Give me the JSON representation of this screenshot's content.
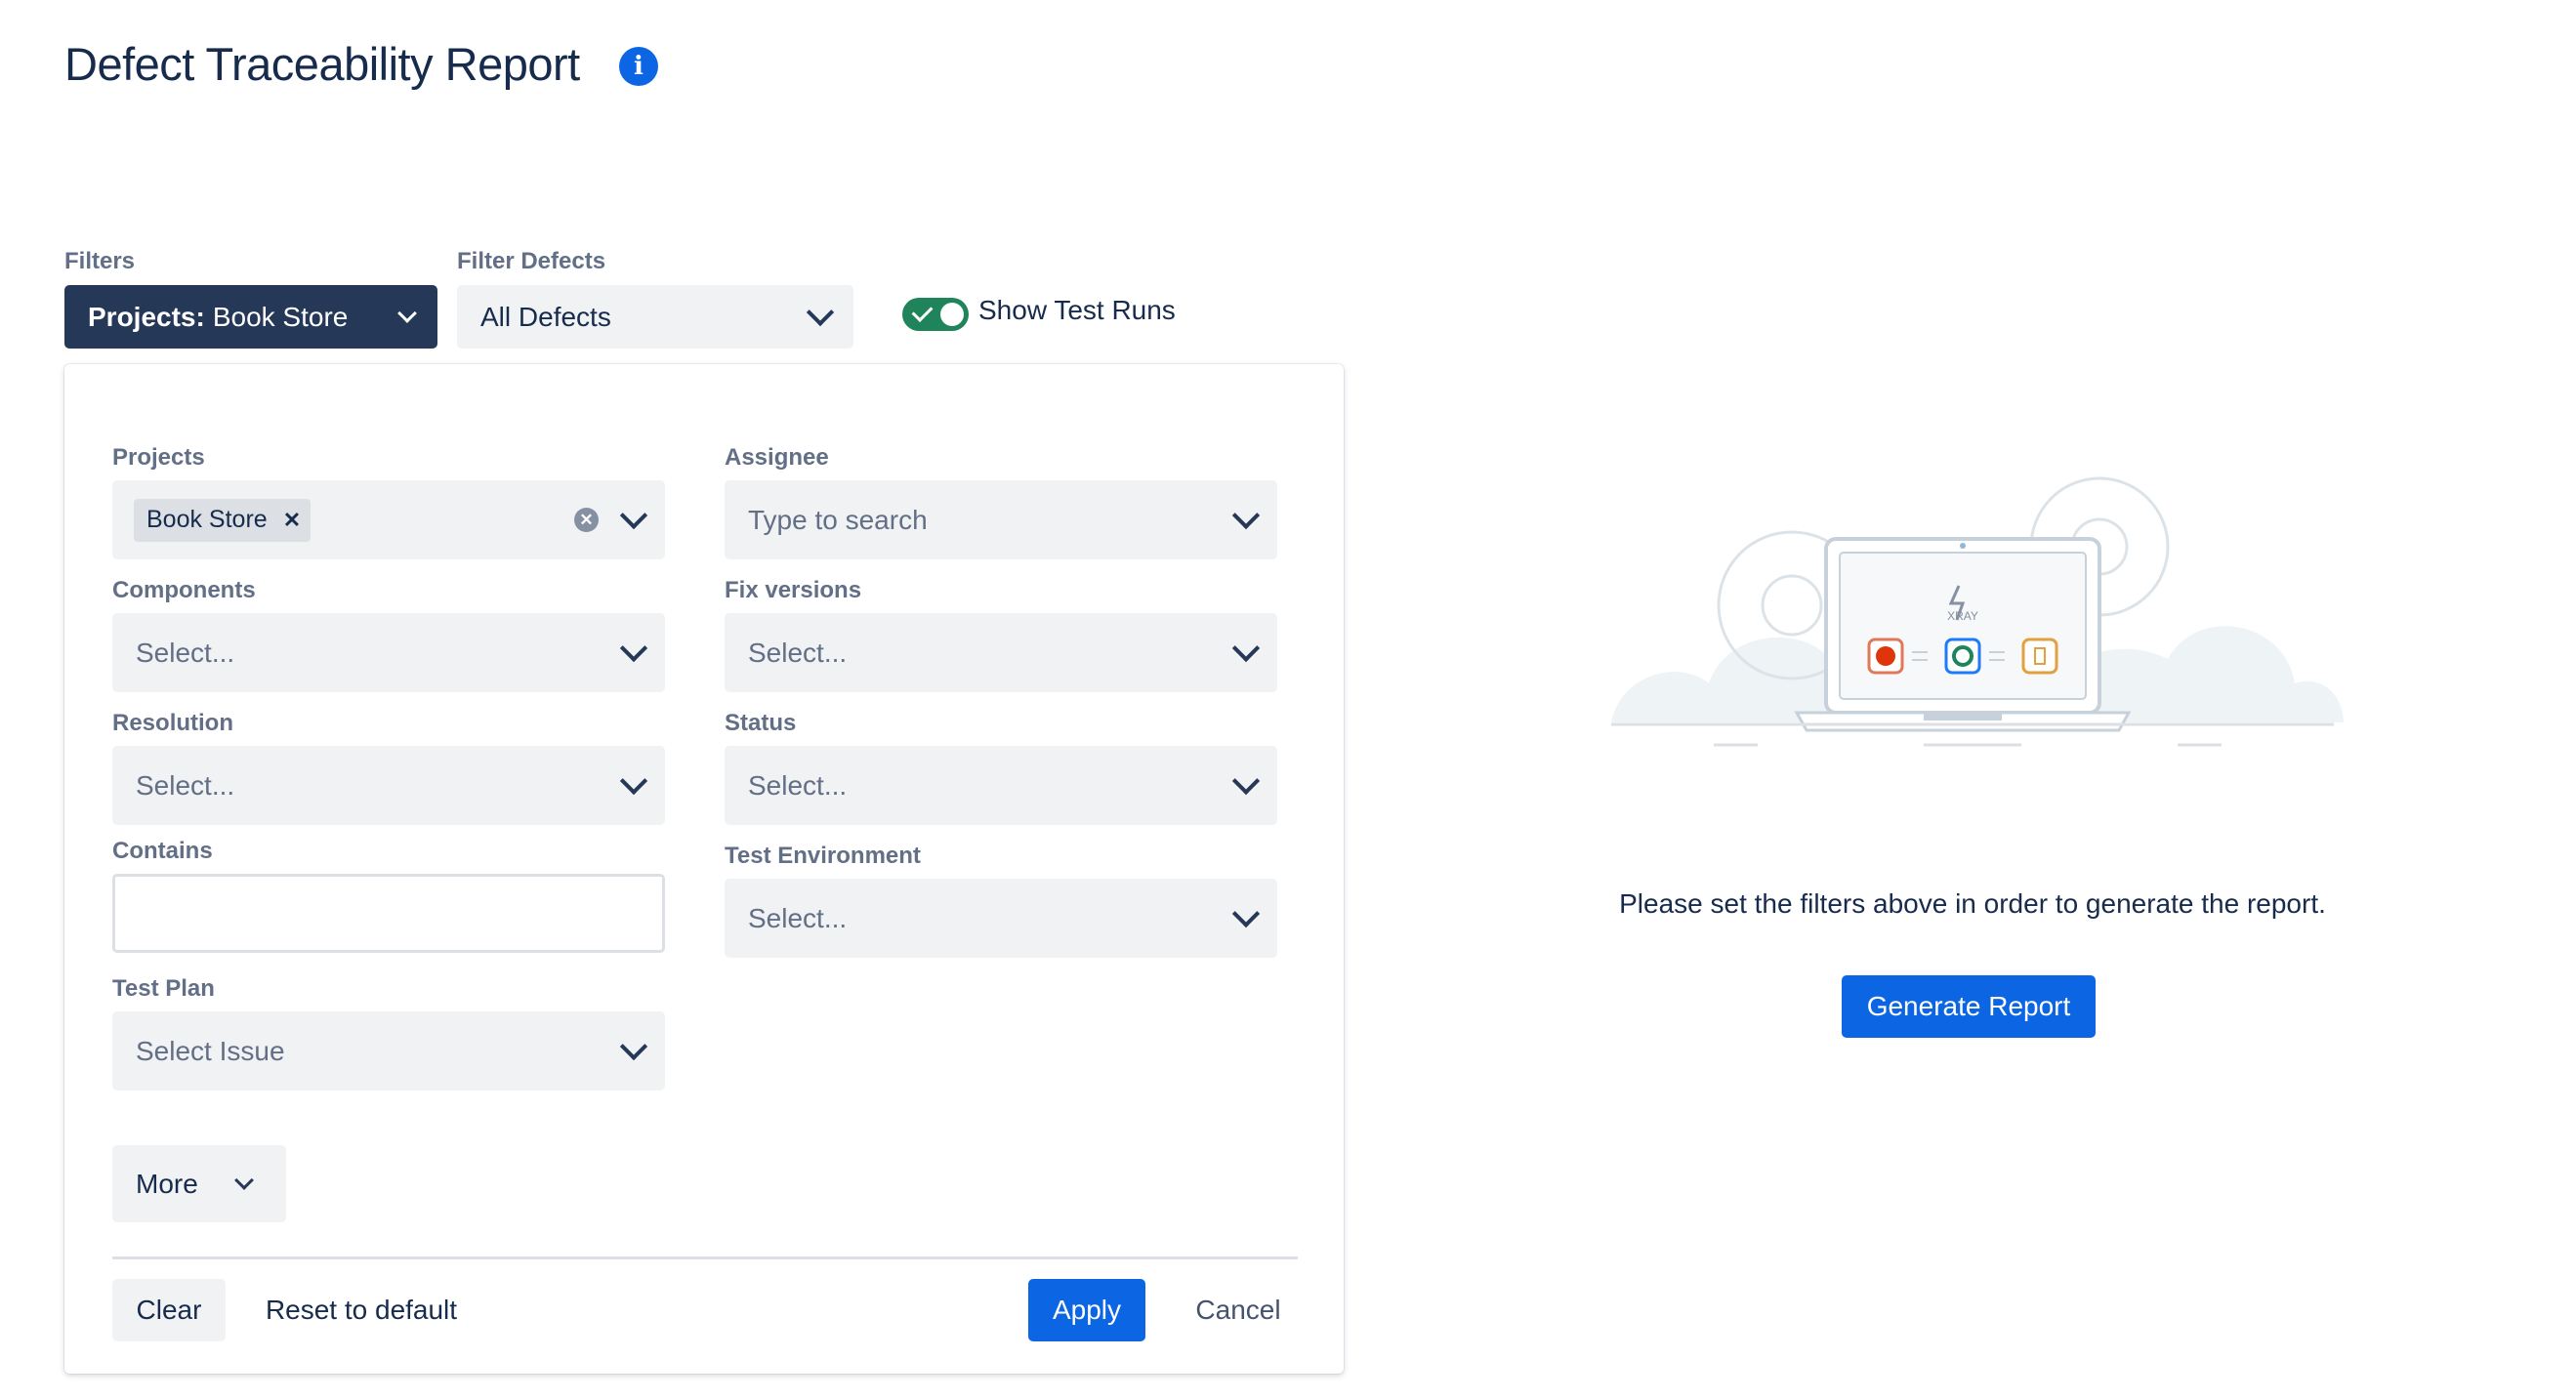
{
  "header": {
    "title": "Defect Traceability Report",
    "info_icon": "info-icon"
  },
  "toolbar": {
    "filters_label": "Filters",
    "filters_button_prefix": "Projects:",
    "filters_button_value": "Book Store",
    "filter_defects_label": "Filter Defects",
    "filter_defects_value": "All Defects",
    "show_test_runs_label": "Show Test Runs",
    "show_test_runs_on": true
  },
  "panel": {
    "projects": {
      "label": "Projects",
      "tags": [
        "Book Store"
      ]
    },
    "assignee": {
      "label": "Assignee",
      "placeholder": "Type to search"
    },
    "components": {
      "label": "Components",
      "placeholder": "Select..."
    },
    "fix_versions": {
      "label": "Fix versions",
      "placeholder": "Select..."
    },
    "resolution": {
      "label": "Resolution",
      "placeholder": "Select..."
    },
    "status": {
      "label": "Status",
      "placeholder": "Select..."
    },
    "contains": {
      "label": "Contains",
      "value": ""
    },
    "test_environment": {
      "label": "Test Environment",
      "placeholder": "Select..."
    },
    "test_plan": {
      "label": "Test Plan",
      "placeholder": "Select Issue"
    },
    "more_label": "More",
    "footer": {
      "clear": "Clear",
      "reset": "Reset to default",
      "apply": "Apply",
      "cancel": "Cancel"
    }
  },
  "empty_state": {
    "illustration_text": "XRAY",
    "message": "Please set the filters above in order to generate the report.",
    "generate_button": "Generate Report"
  },
  "colors": {
    "primary": "#0C66E4",
    "dark_button": "#253858",
    "toggle_on": "#1F845A",
    "field_bg": "#F1F2F4"
  }
}
